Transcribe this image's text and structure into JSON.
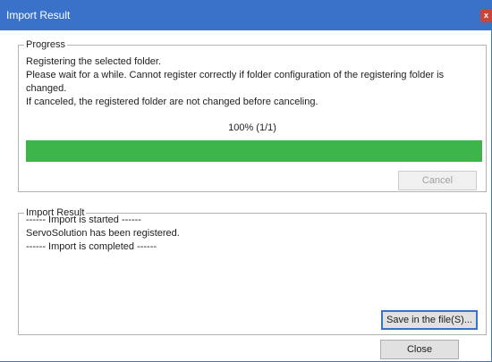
{
  "window": {
    "title": "Import Result",
    "close_glyph": "x"
  },
  "progress": {
    "legend": "Progress",
    "messages": [
      "Registering the selected folder.",
      "Please wait for a while. Cannot register correctly if folder configuration of the registering folder is",
      "changed.",
      "If canceled, the registered folder are not changed before canceling."
    ],
    "percent_text": "100%   (1/1)",
    "fraction_complete": 1.0,
    "bar_color": "#3db54a",
    "cancel_label": "Cancel"
  },
  "result": {
    "legend": "Import Result",
    "log": [
      "------ Import is started ------",
      "ServoSolution has been registered.",
      "------ Import is completed ------"
    ],
    "save_label": "Save in the file(S)..."
  },
  "footer": {
    "close_label": "Close"
  }
}
